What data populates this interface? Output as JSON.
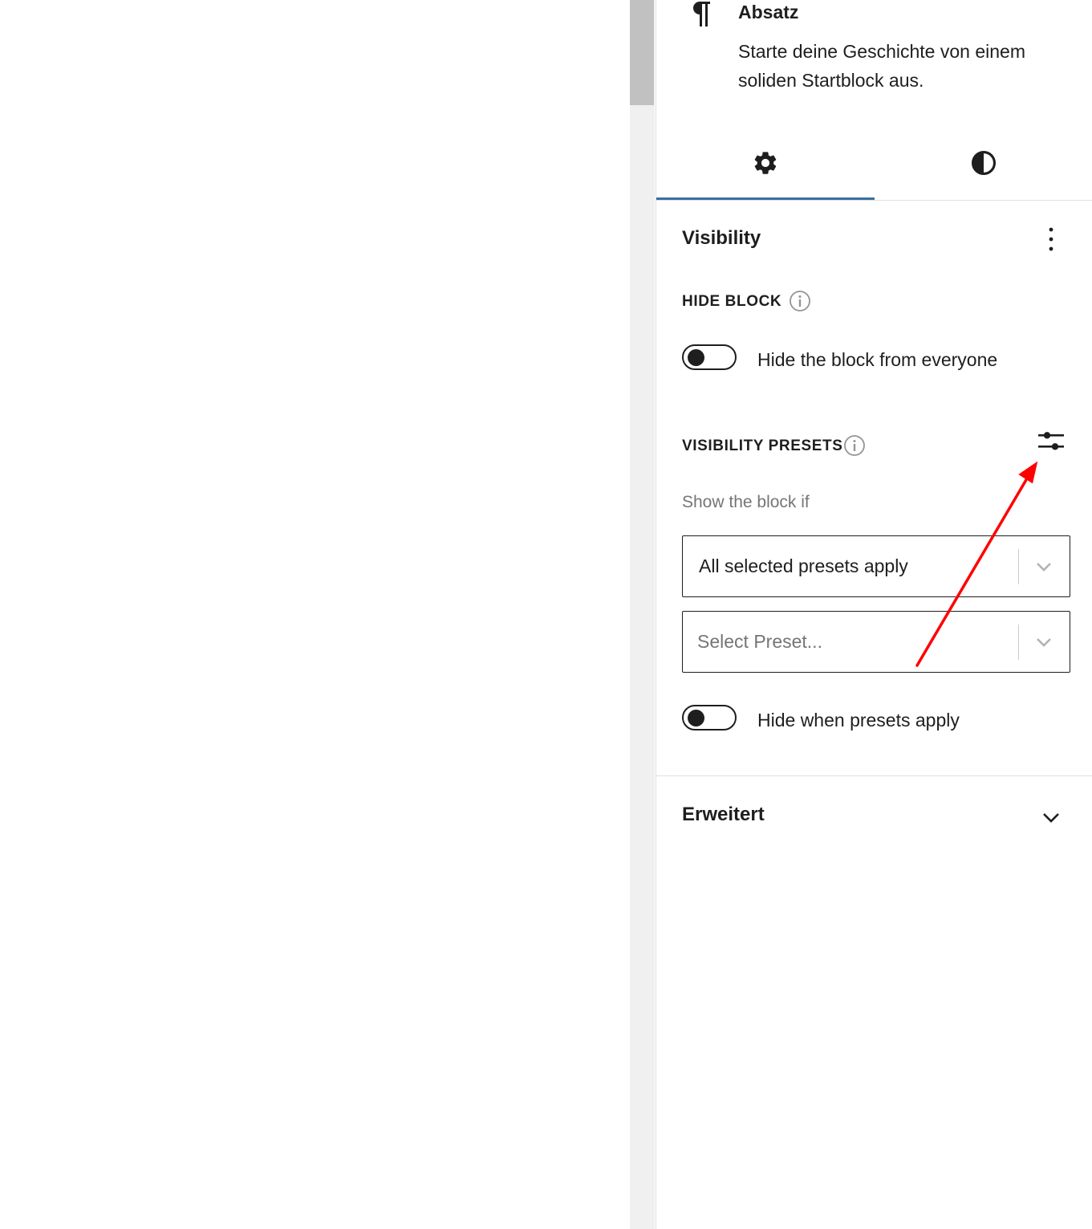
{
  "block": {
    "icon": "pilcrow-icon",
    "title": "Absatz",
    "description": "Starte deine Geschichte von einem soliden Startblock aus."
  },
  "tabs": [
    {
      "icon": "gear-icon",
      "name": "settings",
      "active": true
    },
    {
      "icon": "contrast-icon",
      "name": "styles",
      "active": false
    }
  ],
  "visibility_panel": {
    "title": "Visibility",
    "menu_icon": "more-vertical-icon",
    "hide_block": {
      "label": "HIDE BLOCK",
      "toggle_label": "Hide the block from everyone",
      "checked": false
    },
    "presets": {
      "label": "VISIBILITY PRESETS",
      "hint": "Show the block if",
      "mode_value": "All selected presets apply",
      "preset_placeholder": "Select Preset...",
      "hide_toggle_label": "Hide when presets apply",
      "hide_checked": false
    }
  },
  "advanced_panel": {
    "title": "Erweitert"
  },
  "colors": {
    "accent": "#3a6ea5",
    "annotation_arrow": "#ff0000"
  }
}
